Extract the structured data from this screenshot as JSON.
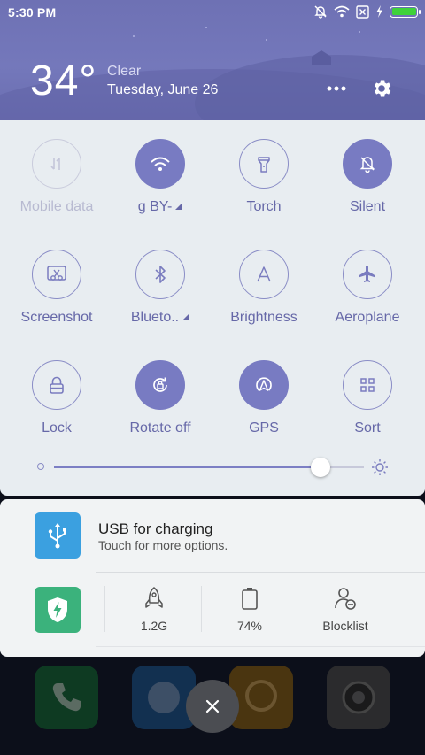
{
  "status_bar": {
    "time": "5:30 PM",
    "battery_level": 1.0,
    "icons": [
      "mute-icon",
      "wifi-icon",
      "no-sim-icon",
      "charging-icon",
      "battery-icon"
    ]
  },
  "header": {
    "temperature": "34°",
    "condition": "Clear",
    "date": "Tuesday, June 26",
    "more_icon": "more-dots-icon",
    "settings_icon": "gear-icon"
  },
  "quick_settings": {
    "tiles": [
      {
        "label": "Mobile data",
        "state": "disabled",
        "icon": "mobile-data-icon"
      },
      {
        "label": "g    BY-",
        "state": "on",
        "icon": "wifi-icon",
        "dropdown": true
      },
      {
        "label": "Torch",
        "state": "off",
        "icon": "torch-icon"
      },
      {
        "label": "Silent",
        "state": "on",
        "icon": "silent-icon"
      },
      {
        "label": "Screenshot",
        "state": "off",
        "icon": "screenshot-icon"
      },
      {
        "label": "Blueto..",
        "state": "off",
        "icon": "bluetooth-icon",
        "dropdown": true
      },
      {
        "label": "Brightness",
        "state": "off",
        "icon": "brightness-auto-icon"
      },
      {
        "label": "Aeroplane",
        "state": "off",
        "icon": "airplane-icon"
      },
      {
        "label": "Lock",
        "state": "off",
        "icon": "lock-icon"
      },
      {
        "label": "Rotate off",
        "state": "on",
        "icon": "rotate-icon"
      },
      {
        "label": "GPS",
        "state": "on",
        "icon": "gps-icon"
      },
      {
        "label": "Sort",
        "state": "off",
        "icon": "grid-icon"
      }
    ],
    "brightness_level": 0.86
  },
  "notifications": {
    "usb": {
      "title": "USB for charging",
      "subtitle": "Touch for more options.",
      "icon": "usb-icon"
    },
    "security": {
      "icon": "shield-bolt-icon",
      "items": [
        {
          "label": "1.2G",
          "icon": "rocket-icon"
        },
        {
          "label": "74%",
          "icon": "battery-outline-icon"
        },
        {
          "label": "Blocklist",
          "icon": "block-user-icon"
        }
      ]
    }
  },
  "colors": {
    "header_bg": "#7074b8",
    "accent": "#787bc2",
    "panel_bg": "#e8edf1",
    "usb_blue": "#3ba0e0",
    "security_green": "#3bb27c"
  }
}
